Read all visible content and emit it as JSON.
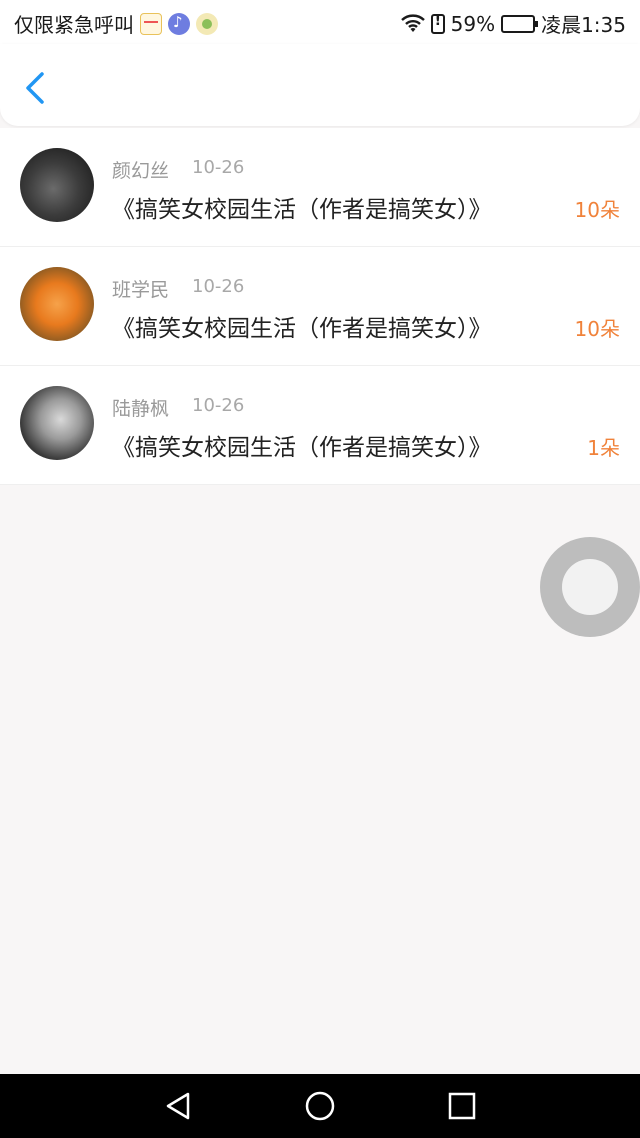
{
  "status_bar": {
    "carrier": "仅限紧急呼叫",
    "battery": "59%",
    "time": "凌晨1:35",
    "battery_level": 0.59
  },
  "nav": {
    "back_icon": "chevron-left-icon",
    "accent_color": "#2196F3"
  },
  "list": {
    "items": [
      {
        "name": "颜幻丝",
        "date": "10-26",
        "title": "《搞笑女校园生活（作者是搞笑女）》",
        "count": "10朵"
      },
      {
        "name": "班学民",
        "date": "10-26",
        "title": "《搞笑女校园生活（作者是搞笑女）》",
        "count": "10朵"
      },
      {
        "name": "陆静枫",
        "date": "10-26",
        "title": "《搞笑女校园生活（作者是搞笑女）》",
        "count": "1朵"
      }
    ],
    "count_color": "#F0823A"
  },
  "android_nav": {
    "icons": [
      "back-triangle-icon",
      "home-circle-icon",
      "recent-square-icon"
    ]
  }
}
